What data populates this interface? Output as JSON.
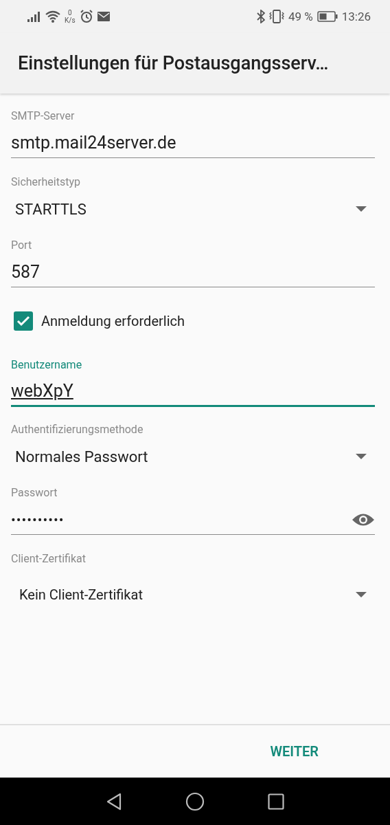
{
  "status_bar": {
    "network_speed": "0",
    "network_unit": "K/s",
    "battery": "49 %",
    "time": "13:26"
  },
  "app_bar": {
    "title": "Einstellungen für Postausgangsserv…"
  },
  "fields": [
    {
      "kind": "text",
      "label": "SMTP-Server",
      "value": "smtp.mail24server.de",
      "focused": false
    },
    {
      "kind": "dropdown",
      "label": "Sicherheitstyp",
      "value": "STARTTLS"
    },
    {
      "kind": "text",
      "label": "Port",
      "value": "587",
      "focused": false
    },
    {
      "kind": "checkbox",
      "label": "Anmeldung erforderlich",
      "checked": true
    },
    {
      "kind": "text",
      "label": "Benutzername",
      "value": "webXpY",
      "focused": true
    },
    {
      "kind": "dropdown",
      "label": "Authentifizierungsmethode",
      "value": "Normales Passwort"
    },
    {
      "kind": "password",
      "label": "Passwort",
      "value": "••••••••••"
    },
    {
      "kind": "dropdown",
      "label": "Client-Zertifikat",
      "value": "Kein Client-Zertifikat",
      "indent": true
    }
  ],
  "footer": {
    "button": "WEITER"
  }
}
